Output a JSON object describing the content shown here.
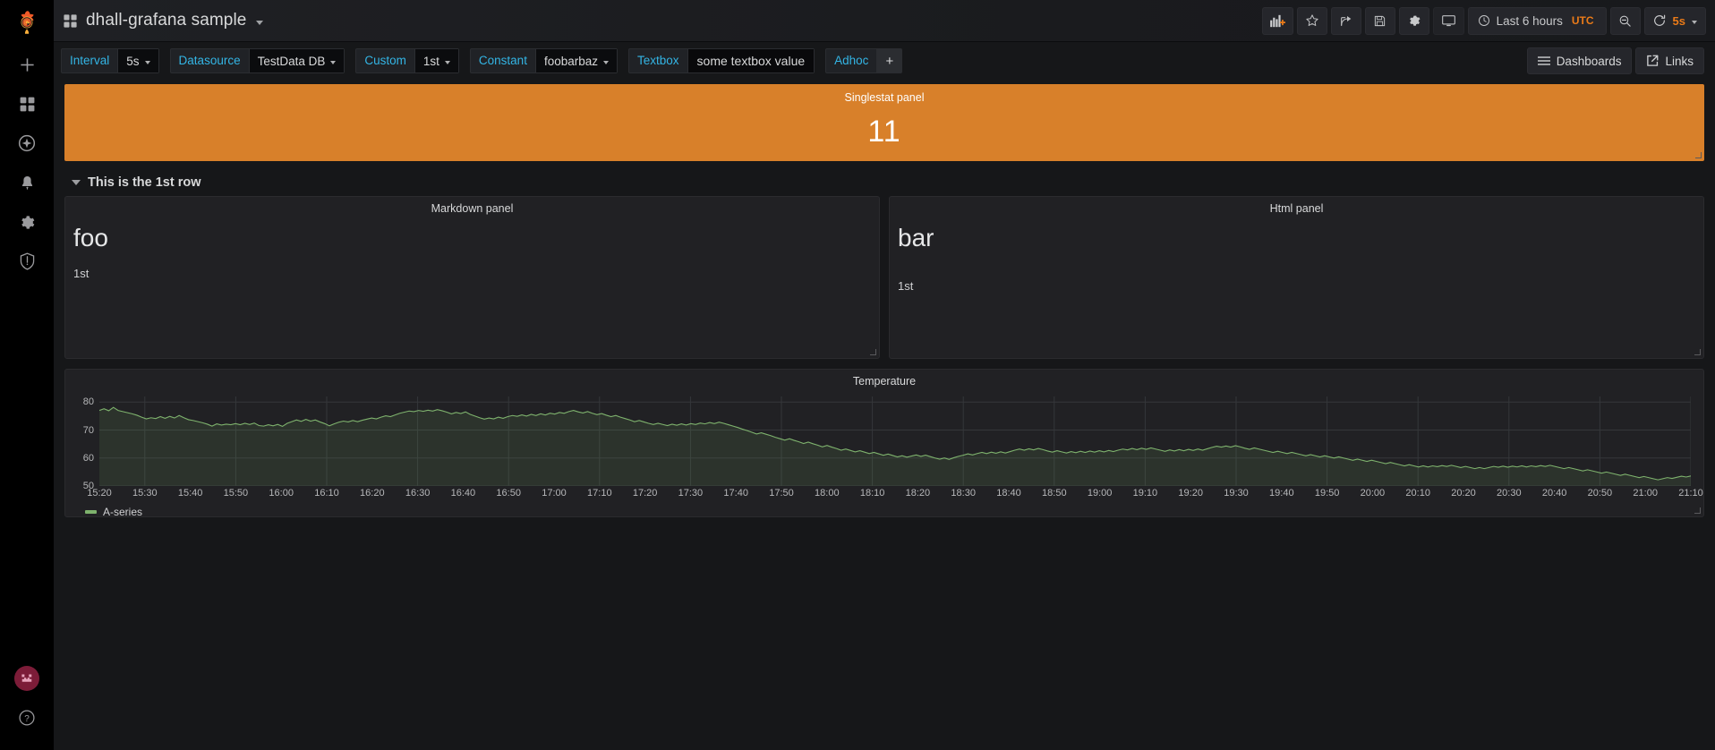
{
  "app": {
    "logo_icon": "grafana-logo-icon",
    "title": "dhall-grafana sample"
  },
  "sidebar": {
    "items": [
      {
        "name": "create",
        "icon": "plus-icon"
      },
      {
        "name": "dashboards",
        "icon": "apps-grid-icon"
      },
      {
        "name": "explore",
        "icon": "compass-icon"
      },
      {
        "name": "alerting",
        "icon": "bell-icon"
      },
      {
        "name": "configuration",
        "icon": "gear-icon"
      },
      {
        "name": "server-admin",
        "icon": "shield-icon"
      }
    ],
    "bottom": [
      {
        "name": "user-profile",
        "icon": "avatar-icon"
      },
      {
        "name": "help",
        "icon": "question-circle-icon"
      }
    ]
  },
  "toolbar": {
    "buttons": [
      {
        "name": "add-panel",
        "icon": "add-panel-icon"
      },
      {
        "name": "mark-favorite",
        "icon": "star-icon"
      },
      {
        "name": "share-dashboard",
        "icon": "share-icon"
      },
      {
        "name": "save-dashboard",
        "icon": "save-icon"
      },
      {
        "name": "dashboard-settings",
        "icon": "gear-icon"
      },
      {
        "name": "tv-mode",
        "icon": "monitor-icon"
      }
    ],
    "time_range": "Last 6 hours",
    "timezone": "UTC",
    "zoom_out_icon": "zoom-out-icon",
    "refresh_icon": "refresh-icon",
    "refresh_interval": "5s"
  },
  "variables": [
    {
      "label": "Interval",
      "value": "5s",
      "type": "dropdown"
    },
    {
      "label": "Datasource",
      "value": "TestData DB",
      "type": "dropdown"
    },
    {
      "label": "Custom",
      "value": "1st",
      "type": "dropdown"
    },
    {
      "label": "Constant",
      "value": "foobarbaz",
      "type": "dropdown"
    },
    {
      "label": "Textbox",
      "value": "some textbox value",
      "type": "textbox"
    },
    {
      "label": "Adhoc",
      "value": "+",
      "type": "adhoc"
    }
  ],
  "submenu_right": {
    "dashboards_label": "Dashboards",
    "dashboards_icon": "list-icon",
    "links_label": "Links",
    "links_icon": "external-link-icon"
  },
  "panels": {
    "singlestat": {
      "title": "Singlestat panel",
      "value": "11",
      "background": "#d8802a",
      "text_color": "#ffffff"
    },
    "row": {
      "title": "This is the 1st row",
      "collapsed": false
    },
    "markdown": {
      "title": "Markdown panel",
      "heading": "foo",
      "body": "1st"
    },
    "html": {
      "title": "Html panel",
      "heading": "bar",
      "body": "1st"
    },
    "graph": {
      "title": "Temperature"
    }
  },
  "chart_data": {
    "type": "line",
    "title": "Temperature",
    "xlabel": "",
    "ylabel": "",
    "ylim": [
      50,
      82
    ],
    "yticks": [
      50,
      60,
      70,
      80
    ],
    "grid": true,
    "legend_position": "bottom-left",
    "x_range": [
      "15:20",
      "21:10"
    ],
    "xticks": [
      "15:20",
      "15:30",
      "15:40",
      "15:50",
      "16:00",
      "16:10",
      "16:20",
      "16:30",
      "16:40",
      "16:50",
      "17:00",
      "17:10",
      "17:20",
      "17:30",
      "17:40",
      "17:50",
      "18:00",
      "18:10",
      "18:20",
      "18:30",
      "18:40",
      "18:50",
      "19:00",
      "19:10",
      "19:20",
      "19:30",
      "19:40",
      "19:50",
      "20:00",
      "20:10",
      "20:20",
      "20:30",
      "20:40",
      "20:50",
      "21:00",
      "21:10"
    ],
    "series": [
      {
        "name": "A-series",
        "color": "#7eb26d",
        "fill": true,
        "values": [
          77.0,
          77.6,
          76.9,
          78.1,
          77.0,
          76.6,
          76.2,
          75.8,
          75.3,
          74.6,
          74.0,
          74.4,
          74.1,
          74.8,
          74.2,
          74.9,
          74.3,
          75.2,
          74.4,
          73.7,
          73.4,
          73.0,
          72.6,
          72.1,
          71.4,
          72.2,
          71.8,
          72.1,
          71.9,
          72.3,
          71.9,
          72.4,
          72.0,
          72.5,
          71.6,
          71.4,
          71.9,
          71.5,
          72.0,
          71.3,
          72.4,
          73.0,
          73.6,
          73.1,
          73.8,
          73.2,
          73.6,
          72.9,
          72.3,
          71.5,
          72.2,
          72.8,
          73.2,
          72.9,
          73.4,
          73.0,
          73.5,
          73.9,
          74.3,
          74.0,
          74.6,
          75.1,
          74.8,
          75.4,
          76.0,
          76.4,
          76.8,
          76.6,
          77.0,
          76.7,
          77.1,
          76.8,
          77.3,
          76.9,
          76.4,
          75.8,
          76.3,
          75.9,
          76.5,
          75.6,
          75.0,
          74.4,
          73.9,
          74.3,
          74.0,
          74.6,
          74.2,
          74.8,
          75.2,
          74.9,
          75.4,
          75.0,
          75.6,
          75.2,
          75.8,
          75.4,
          76.0,
          75.7,
          76.3,
          76.0,
          76.6,
          77.0,
          76.5,
          76.1,
          76.6,
          76.0,
          75.5,
          75.9,
          75.3,
          74.8,
          75.2,
          74.6,
          74.1,
          73.6,
          73.0,
          73.4,
          72.9,
          72.4,
          72.0,
          72.4,
          72.0,
          71.6,
          72.1,
          71.7,
          72.2,
          71.8,
          72.3,
          72.0,
          72.5,
          72.2,
          72.7,
          72.3,
          72.8,
          72.4,
          71.9,
          71.4,
          70.9,
          70.3,
          69.8,
          69.2,
          68.6,
          69.0,
          68.5,
          68.0,
          67.4,
          66.9,
          66.4,
          66.9,
          66.3,
          65.8,
          65.2,
          65.7,
          65.1,
          64.6,
          64.0,
          64.5,
          63.9,
          63.4,
          62.8,
          63.2,
          62.7,
          62.2,
          62.6,
          62.1,
          61.6,
          62.0,
          61.5,
          61.0,
          61.4,
          60.9,
          60.4,
          60.8,
          60.3,
          60.7,
          61.1,
          60.6,
          61.0,
          60.5,
          60.0,
          59.6,
          60.0,
          59.5,
          60.1,
          60.6,
          61.0,
          61.5,
          61.1,
          61.6,
          62.0,
          61.6,
          62.1,
          61.7,
          62.2,
          61.8,
          62.3,
          62.8,
          63.2,
          62.8,
          63.3,
          62.9,
          63.4,
          63.0,
          62.5,
          62.1,
          62.6,
          62.2,
          61.8,
          62.3,
          61.9,
          62.4,
          62.0,
          62.5,
          62.1,
          62.6,
          62.2,
          62.7,
          62.3,
          62.8,
          63.2,
          62.9,
          63.4,
          63.0,
          63.5,
          63.1,
          63.6,
          63.2,
          62.8,
          62.4,
          62.9,
          62.5,
          63.0,
          62.6,
          63.1,
          62.7,
          63.2,
          62.8,
          63.3,
          63.8,
          64.2,
          63.9,
          64.3,
          63.9,
          64.4,
          64.0,
          63.5,
          63.1,
          63.6,
          63.2,
          62.8,
          62.4,
          62.0,
          62.4,
          62.0,
          61.6,
          62.0,
          61.6,
          61.2,
          60.8,
          61.2,
          60.8,
          60.4,
          60.8,
          60.4,
          60.0,
          60.4,
          60.0,
          59.6,
          59.2,
          59.6,
          59.2,
          58.8,
          59.2,
          58.8,
          58.4,
          58.0,
          58.4,
          58.0,
          57.6,
          57.2,
          57.6,
          57.2,
          56.8,
          57.2,
          56.8,
          57.2,
          56.9,
          57.3,
          57.0,
          57.4,
          57.0,
          56.6,
          57.0,
          56.6,
          56.2,
          56.6,
          56.2,
          56.6,
          57.0,
          56.7,
          57.1,
          56.7,
          57.1,
          56.8,
          57.2,
          56.8,
          57.2,
          56.9,
          57.3,
          57.0,
          57.4,
          57.0,
          56.6,
          56.2,
          56.6,
          56.2,
          55.8,
          55.4,
          55.8,
          55.4,
          55.0,
          54.6,
          55.0,
          54.6,
          54.2,
          53.8,
          54.2,
          53.8,
          53.4,
          53.0,
          53.4,
          53.0,
          52.6,
          52.2,
          52.6,
          53.0,
          52.7,
          53.1,
          53.5,
          53.2,
          53.6
        ]
      }
    ]
  }
}
